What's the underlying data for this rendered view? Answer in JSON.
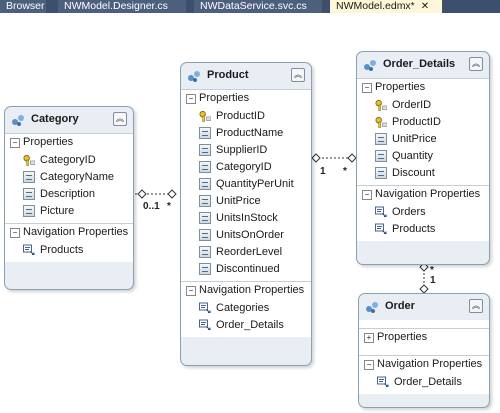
{
  "tabs": [
    {
      "label": "Browser",
      "active": false
    },
    {
      "label": "NWModel.Designer.cs",
      "active": false
    },
    {
      "label": "NWDataService.svc.cs",
      "active": false
    },
    {
      "label": "NWModel.edmx*",
      "active": true,
      "close": "✕"
    }
  ],
  "sections": {
    "properties": "Properties",
    "navigation": "Navigation Properties"
  },
  "entities": {
    "category": {
      "title": "Category",
      "properties": [
        "CategoryID",
        "CategoryName",
        "Description",
        "Picture"
      ],
      "navigation": [
        "Products"
      ]
    },
    "product": {
      "title": "Product",
      "properties": [
        "ProductID",
        "ProductName",
        "SupplierID",
        "CategoryID",
        "QuantityPerUnit",
        "UnitPrice",
        "UnitsInStock",
        "UnitsOnOrder",
        "ReorderLevel",
        "Discontinued"
      ],
      "navigation": [
        "Categories",
        "Order_Details"
      ]
    },
    "order_details": {
      "title": "Order_Details",
      "properties": [
        "OrderID",
        "ProductID",
        "UnitPrice",
        "Quantity",
        "Discount"
      ],
      "navigation": [
        "Orders",
        "Products"
      ]
    },
    "order": {
      "title": "Order",
      "properties": [],
      "navigation": [
        "Order_Details"
      ]
    }
  },
  "multiplicities": {
    "category_product_left": "0..1",
    "category_product_right": "*",
    "product_details_left": "1",
    "product_details_right": "*",
    "details_order_top": "*",
    "details_order_bottom": "1"
  }
}
